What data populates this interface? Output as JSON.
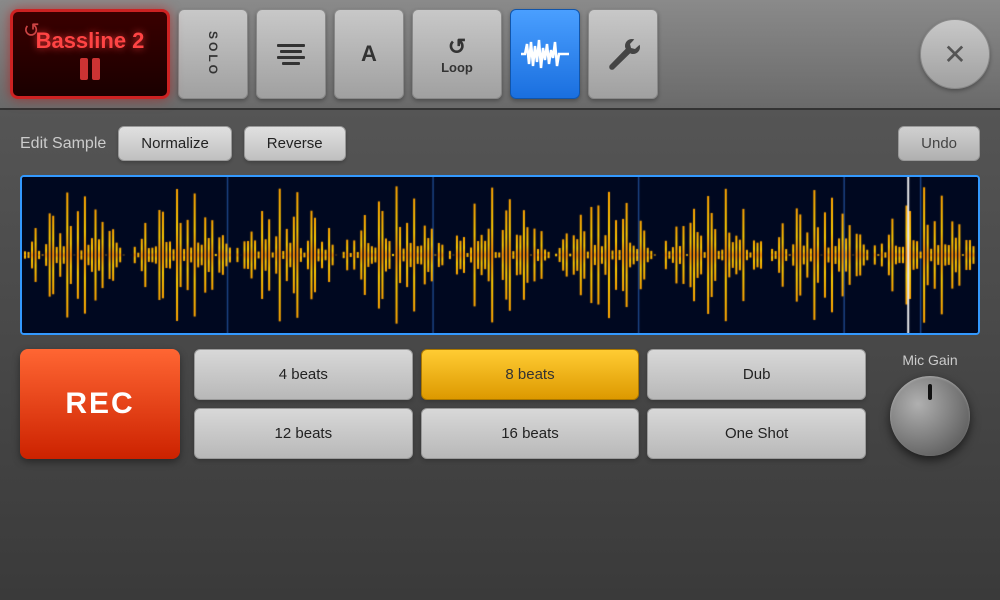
{
  "toolbar": {
    "track_name": "Bassline 2",
    "solo_label": "SOLO",
    "lines_icon": "lines-icon",
    "a_label": "A",
    "loop_label": "Loop",
    "waveform_icon": "waveform-icon",
    "wrench_icon": "wrench-icon",
    "close_label": "✕"
  },
  "edit_sample": {
    "label": "Edit Sample",
    "normalize_btn": "Normalize",
    "reverse_btn": "Reverse",
    "undo_btn": "Undo"
  },
  "beat_buttons": [
    {
      "id": "4beats",
      "label": "4 beats",
      "selected": false
    },
    {
      "id": "8beats",
      "label": "8 beats",
      "selected": true
    },
    {
      "id": "dub",
      "label": "Dub",
      "selected": false
    },
    {
      "id": "12beats",
      "label": "12 beats",
      "selected": false
    },
    {
      "id": "16beats",
      "label": "16 beats",
      "selected": false
    },
    {
      "id": "oneshot",
      "label": "One Shot",
      "selected": false
    }
  ],
  "rec_btn": "REC",
  "mic_gain": {
    "label": "Mic Gain",
    "value": 45
  }
}
